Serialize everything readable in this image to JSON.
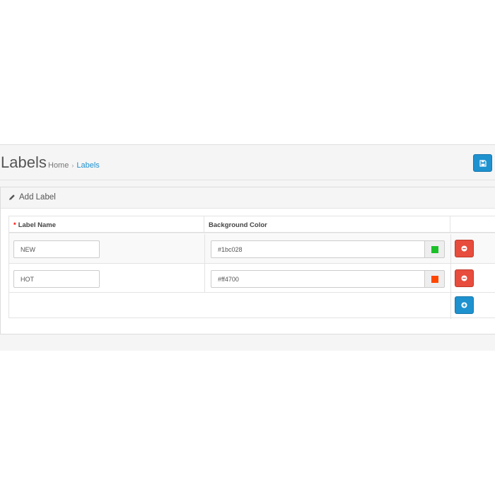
{
  "header": {
    "title": "Labels",
    "breadcrumb": {
      "home": "Home",
      "separator": "›",
      "current": "Labels"
    }
  },
  "panel": {
    "title": "Add Label"
  },
  "table": {
    "columns": {
      "name": "Label Name",
      "color": "Background Color",
      "required_mark": "*"
    },
    "rows": [
      {
        "name": "NEW",
        "color": "#1bc028"
      },
      {
        "name": "HOT",
        "color": "#ff4700"
      }
    ]
  },
  "icons": {
    "save": "save-icon",
    "edit": "pencil-icon",
    "remove": "minus-circle-icon",
    "add": "plus-circle-icon"
  },
  "colors": {
    "primary": "#1e91cf",
    "danger": "#e74c3c",
    "link": "#1e91cf"
  }
}
